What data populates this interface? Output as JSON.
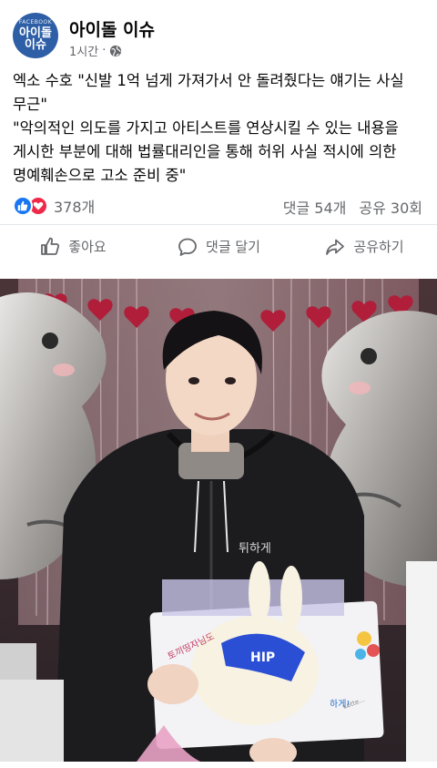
{
  "page": {
    "name": "아이돌 이슈",
    "avatar_top": "FACEBOOK",
    "avatar_line1": "아이돌",
    "avatar_line2": "이슈",
    "time": "1시간",
    "separator": "·"
  },
  "post": {
    "line1": "엑소 수호 \"신발 1억 넘게 가져가서 안 돌려줬다는 얘기는 사실\n무근\"",
    "line2": "\"악의적인 의도를 가지고 아티스트를 연상시킬 수 있는 내용을\n게시한 부분에 대해 법률대리인을 통해 허위 사실 적시에 의한\n명예훼손으로 고소 준비 중\""
  },
  "stats": {
    "reaction_count": "378개",
    "comments": "댓글 54개",
    "shares": "공유 30회"
  },
  "actions": {
    "like": "좋아요",
    "comment": "댓글 달기",
    "share": "공유하기"
  },
  "photo": {
    "icons": [
      "like-icon",
      "comment-icon",
      "share-icon",
      "globe-icon"
    ],
    "hoodie_text": "튀하게",
    "cake_label": "HIP",
    "cake_board_left": "토끼띵자님도",
    "cake_board_right": "하게!",
    "cake_board_tag": "Lotte..."
  },
  "colors": {
    "brand_blue": "#1877f2",
    "love_red": "#f02849",
    "meta_gray": "#65676b",
    "avatar_bg": "#2e5fa6"
  }
}
